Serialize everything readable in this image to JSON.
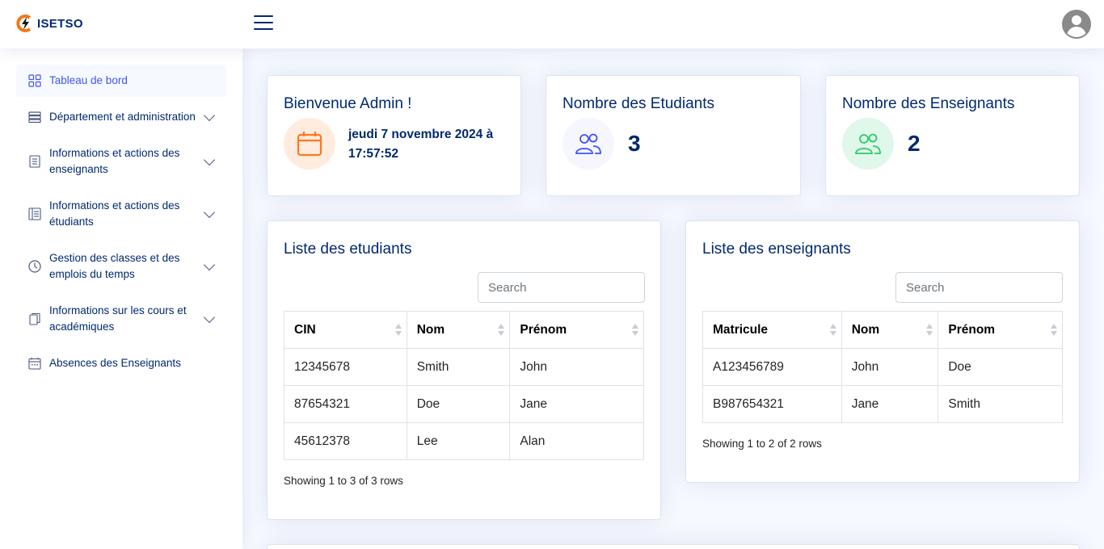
{
  "header": {
    "logo_text": "ISETSO"
  },
  "sidebar": {
    "items": [
      {
        "label": "Tableau de bord",
        "icon": "grid-icon"
      },
      {
        "label": "Département et administration",
        "icon": "server-icon"
      },
      {
        "label": "Informations et actions des enseignants",
        "icon": "list-doc-icon"
      },
      {
        "label": "Informations et actions des étudiants",
        "icon": "layout-text-icon"
      },
      {
        "label": "Gestion des classes et des emplois du temps",
        "icon": "clock-icon"
      },
      {
        "label": "Informations sur les cours et académiques",
        "icon": "copy-icon"
      },
      {
        "label": "Absences des Enseignants",
        "icon": "calendar-icon"
      }
    ]
  },
  "welcome": {
    "title": "Bienvenue Admin !",
    "datetime": "jeudi 7 novembre 2024 à 17:57:52"
  },
  "students_stat": {
    "title": "Nombre des Etudiants",
    "count": "3"
  },
  "teachers_stat": {
    "title": "Nombre des Enseignants",
    "count": "2"
  },
  "students_list": {
    "title": "Liste des etudiants",
    "search_placeholder": "Search",
    "columns": [
      "CIN",
      "Nom",
      "Prénom"
    ],
    "rows": [
      [
        "12345678",
        "Smith",
        "John"
      ],
      [
        "87654321",
        "Doe",
        "Jane"
      ],
      [
        "45612378",
        "Lee",
        "Alan"
      ]
    ],
    "showing": "Showing 1 to 3 of 3 rows"
  },
  "teachers_list": {
    "title": "Liste des enseignants",
    "search_placeholder": "Search",
    "columns": [
      "Matricule",
      "Nom",
      "Prénom"
    ],
    "rows": [
      [
        "A123456789",
        "John",
        "Doe"
      ],
      [
        "B987654321",
        "Jane",
        "Smith"
      ]
    ],
    "showing": "Showing 1 to 2 of 2 rows"
  },
  "colors": {
    "primary": "#4154f1",
    "navy": "#012970",
    "orange": "#ff771d",
    "green": "#2eca6a"
  }
}
